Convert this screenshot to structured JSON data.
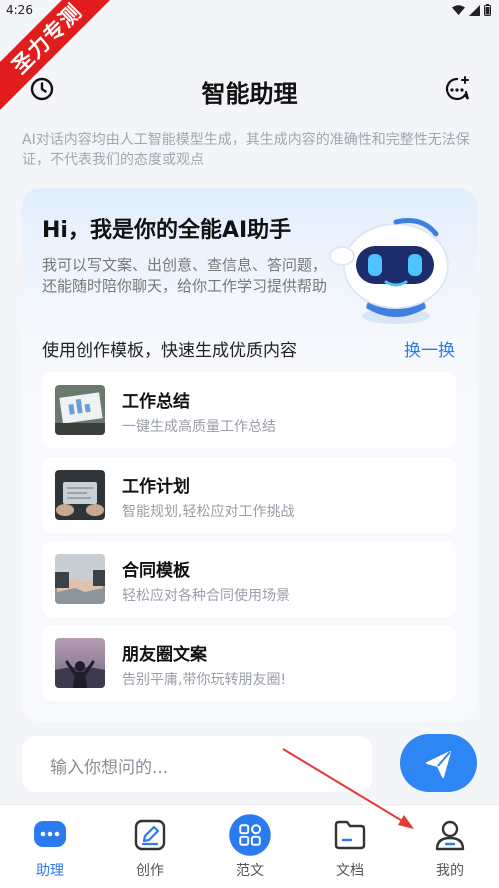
{
  "status_bar": {
    "time": "4:26"
  },
  "ribbon": {
    "text": "圣力专测"
  },
  "header": {
    "title": "智能助理",
    "history_icon": "clock-icon",
    "newchat_icon": "chat-plus-icon"
  },
  "disclaimer": "AI对话内容均由人工智能模型生成，其生成内容的准确性和完整性无法保证，不代表我们的态度或观点",
  "intro": {
    "title": "Hi，我是你的全能AI助手",
    "description": "我可以写文案、出创意、查信息、答问题，还能随时陪你聊天，给你工作学习提供帮助"
  },
  "templates": {
    "header": "使用创作模板，快速生成优质内容",
    "refresh_label": "换一换",
    "items": [
      {
        "title": "工作总结",
        "subtitle": "一键生成高质量工作总结"
      },
      {
        "title": "工作计划",
        "subtitle": "智能规划,轻松应对工作挑战"
      },
      {
        "title": "合同模板",
        "subtitle": "轻松应对各种合同使用场景"
      },
      {
        "title": "朋友圈文案",
        "subtitle": "告别平庸,带你玩转朋友圈!"
      }
    ]
  },
  "input": {
    "placeholder": "输入你想问的..."
  },
  "nav": {
    "items": [
      {
        "label": "助理",
        "icon": "chat-bubble-icon",
        "active": true
      },
      {
        "label": "创作",
        "icon": "edit-pen-icon",
        "active": false
      },
      {
        "label": "范文",
        "icon": "grid-apps-icon",
        "active": false
      },
      {
        "label": "文档",
        "icon": "folder-icon",
        "active": false
      },
      {
        "label": "我的",
        "icon": "user-icon",
        "active": false
      }
    ]
  },
  "colors": {
    "accent": "#2b7bf0",
    "ribbon": "#e21c1c",
    "annotation": "#e53935"
  }
}
